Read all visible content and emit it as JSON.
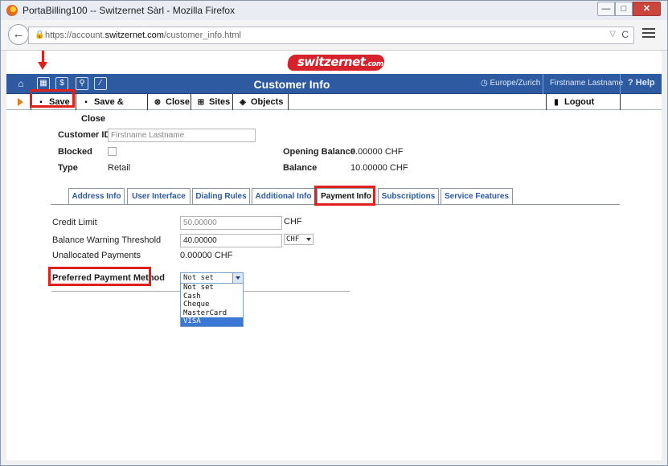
{
  "browser": {
    "window_title": "PortaBilling100 -- Switzernet Sàrl - Mozilla Firefox",
    "url_prefix": "https://account.",
    "url_domain": "switzernet.com",
    "url_path": "/customer_info.html",
    "min_glyph": "—",
    "max_glyph": "□",
    "close_glyph": "✕",
    "back_glyph": "←",
    "lock_glyph": "🔒",
    "drop_glyph": "▽",
    "reload_glyph": "C"
  },
  "logo": {
    "text": "switzernet",
    "suffix": ".com"
  },
  "appbar": {
    "title": "Customer Info",
    "timezone": "Europe/Zurich",
    "user": "Firstname Lastname",
    "help": "Help",
    "icons": [
      "home-icon",
      "grid-icon",
      "dollar-icon",
      "person-icon",
      "chart-icon"
    ],
    "home_glyph": "⌂",
    "grid_glyph": "▦",
    "dollar_glyph": "$",
    "person_glyph": "⚲",
    "chart_glyph": "⁄",
    "tz_glyph": "◷",
    "help_glyph": "?"
  },
  "toolbar": {
    "save": "Save",
    "save_close": "Save & Close",
    "close": "Close",
    "sites": "Sites",
    "objects": "Objects",
    "logout": "Logout",
    "save_glyph": "▪",
    "save_close_glyph": "▪",
    "close_glyph": "⊗",
    "sites_glyph": "⊞",
    "objects_glyph": "◈",
    "logout_glyph": "▮"
  },
  "customer": {
    "id_label": "Customer ID",
    "id_placeholder": "Firstname Lastname",
    "blocked_label": "Blocked",
    "type_label": "Type",
    "type_value": "Retail",
    "opening_balance_label": "Opening Balance",
    "opening_balance_value": "0.00000 CHF",
    "balance_label": "Balance",
    "balance_value": "10.00000 CHF"
  },
  "tabs": [
    "Address Info",
    "User Interface",
    "Dialing Rules",
    "Additional Info",
    "Payment Info",
    "Subscriptions",
    "Service Features"
  ],
  "payment": {
    "credit_limit_label": "Credit Limit",
    "credit_limit_value": "50.00000",
    "credit_limit_currency": "CHF",
    "warning_label": "Balance Warning Threshold",
    "warning_value": "40.00000",
    "warning_currency": "CHF",
    "unallocated_label": "Unallocated Payments",
    "unallocated_value": "0.00000  CHF",
    "method_label": "Preferred Payment Method",
    "method_selected": "Not set",
    "method_options": [
      "Not set",
      "Cash",
      "Cheque",
      "MasterCard",
      "VISA"
    ]
  },
  "colors": {
    "header_blue": "#2d5aa0",
    "highlight_red": "#e0201a",
    "tab_text": "#2d5aa0"
  }
}
